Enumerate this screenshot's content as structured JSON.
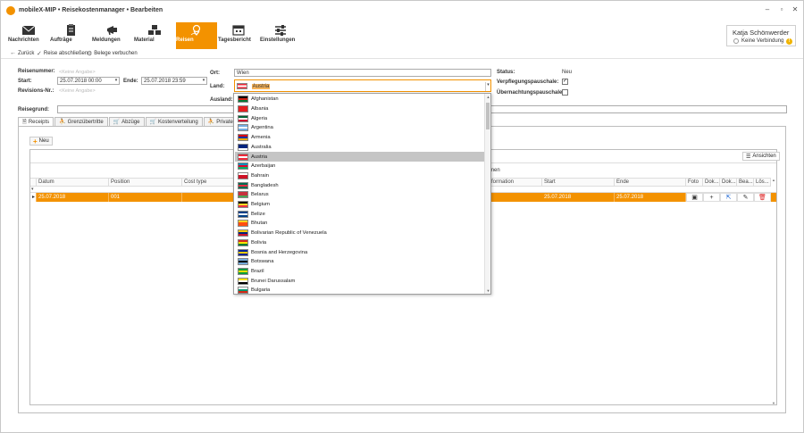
{
  "app": {
    "title": "mobileX-MIP • Reisekostenmanager • Bearbeiten",
    "minimize": "–",
    "maximize": "▫",
    "close": "✕"
  },
  "ribbon": {
    "items": [
      {
        "label": "Nachrichten",
        "icon": "envelope-icon"
      },
      {
        "label": "Aufträge",
        "icon": "clipboard-icon"
      },
      {
        "label": "Meldungen",
        "icon": "megaphone-icon"
      },
      {
        "label": "Material",
        "icon": "boxes-icon"
      },
      {
        "label": "Reisen",
        "icon": "route-pin-icon"
      },
      {
        "label": "Tagesbericht",
        "icon": "calendar-icon"
      },
      {
        "label": "Einstellungen",
        "icon": "sliders-icon"
      }
    ],
    "active_color": "#f39200"
  },
  "user": {
    "name": "Katja Schönwerder",
    "status": "Keine Verbindung",
    "warning": "!"
  },
  "toolbar": {
    "back": "Zurück",
    "close_trip": "Reise abschließen",
    "book_receipts": "Belege verbuchen"
  },
  "form": {
    "reisenummer_label": "Reisenummer:",
    "reisenummer_value": "<Keine Angabe>",
    "start_label": "Start:",
    "start_value": "25.07.2018 00:00",
    "ende_label": "Ende:",
    "ende_value": "25.07.2018 23:59",
    "revision_label": "Revisions-Nr.:",
    "revision_value": "<Keine Angabe>",
    "ort_label": "Ort:",
    "ort_value": "Wien",
    "land_label": "Land:",
    "land_value": "Austria",
    "ausland_label": "Ausland:",
    "status_label": "Status:",
    "status_value": "Neu",
    "verpflegung_label": "Verpflegungspauschale:",
    "verpflegung_checked": "✓",
    "uebernachtung_label": "Übernachtungspauschale:",
    "reisegrund_label": "Reisegrund:"
  },
  "tabs": [
    {
      "label": "Receipts",
      "icon": "receipt-icon"
    },
    {
      "label": "Grenzübertritte",
      "icon": "person-border-icon"
    },
    {
      "label": "Abzüge",
      "icon": "cart-icon"
    },
    {
      "label": "Kostenverteilung",
      "icon": "cart-icon"
    },
    {
      "label": "Private Fahrten",
      "icon": "person-car-icon"
    }
  ],
  "grid": {
    "new_label": "Neu",
    "views_label": "Ansichten",
    "group_text": "men",
    "columns": [
      "Datum",
      "Position",
      "Cost type",
      "formation",
      "Start",
      "Ende",
      "Foto",
      "Dok...",
      "Dok...",
      "Bea...",
      "Lös..."
    ],
    "row": {
      "datum": "25.07.2018",
      "position": "001",
      "start": "25.07.2018",
      "ende": "25.07.2018"
    },
    "filter_icon": "▾",
    "row_marker": "▸"
  },
  "countries": [
    {
      "name": "Afghanistan",
      "flag": [
        "#000000",
        "#d32011",
        "#007a36"
      ]
    },
    {
      "name": "Albania",
      "flag": [
        "#e41e20",
        "#e41e20",
        "#e41e20"
      ]
    },
    {
      "name": "Algeria",
      "flag": [
        "#006233",
        "#ffffff",
        "#d21034"
      ]
    },
    {
      "name": "Argentina",
      "flag": [
        "#74acdf",
        "#ffffff",
        "#74acdf"
      ]
    },
    {
      "name": "Armenia",
      "flag": [
        "#d90012",
        "#0033a0",
        "#f2a800"
      ]
    },
    {
      "name": "Australia",
      "flag": [
        "#00247d",
        "#00247d",
        "#ffffff"
      ]
    },
    {
      "name": "Austria",
      "flag": [
        "#ed2939",
        "#ffffff",
        "#ed2939"
      ]
    },
    {
      "name": "Azerbaijan",
      "flag": [
        "#0092bc",
        "#e4002b",
        "#00af66"
      ]
    },
    {
      "name": "Bahrain",
      "flag": [
        "#ffffff",
        "#ce1126",
        "#ce1126"
      ]
    },
    {
      "name": "Bangladesh",
      "flag": [
        "#006a4e",
        "#f42a41",
        "#006a4e"
      ]
    },
    {
      "name": "Belarus",
      "flag": [
        "#c8313e",
        "#c8313e",
        "#4aa657"
      ]
    },
    {
      "name": "Belgium",
      "flag": [
        "#000000",
        "#fdda24",
        "#ef3340"
      ]
    },
    {
      "name": "Belize",
      "flag": [
        "#003f87",
        "#ffffff",
        "#003f87"
      ]
    },
    {
      "name": "Bhutan",
      "flag": [
        "#ffd520",
        "#ff4e12",
        "#ff4e12"
      ]
    },
    {
      "name": "Bolivarian Republic of Venezuela",
      "flag": [
        "#ffcc00",
        "#00247d",
        "#cf142b"
      ]
    },
    {
      "name": "Bolivia",
      "flag": [
        "#d52b1e",
        "#f9e300",
        "#007934"
      ]
    },
    {
      "name": "Bosnia and Herzegovina",
      "flag": [
        "#002395",
        "#fecb00",
        "#002395"
      ]
    },
    {
      "name": "Botswana",
      "flag": [
        "#75aadb",
        "#000000",
        "#75aadb"
      ]
    },
    {
      "name": "Brazil",
      "flag": [
        "#009c3b",
        "#ffdf00",
        "#009c3b"
      ]
    },
    {
      "name": "Brunei Darussalam",
      "flag": [
        "#f7e017",
        "#ffffff",
        "#000000"
      ]
    },
    {
      "name": "Bulgaria",
      "flag": [
        "#ffffff",
        "#00966e",
        "#d62612"
      ]
    }
  ],
  "selected_country": "Austria",
  "colors": {
    "accent": "#f39200",
    "selection": "#c5c5c5"
  }
}
